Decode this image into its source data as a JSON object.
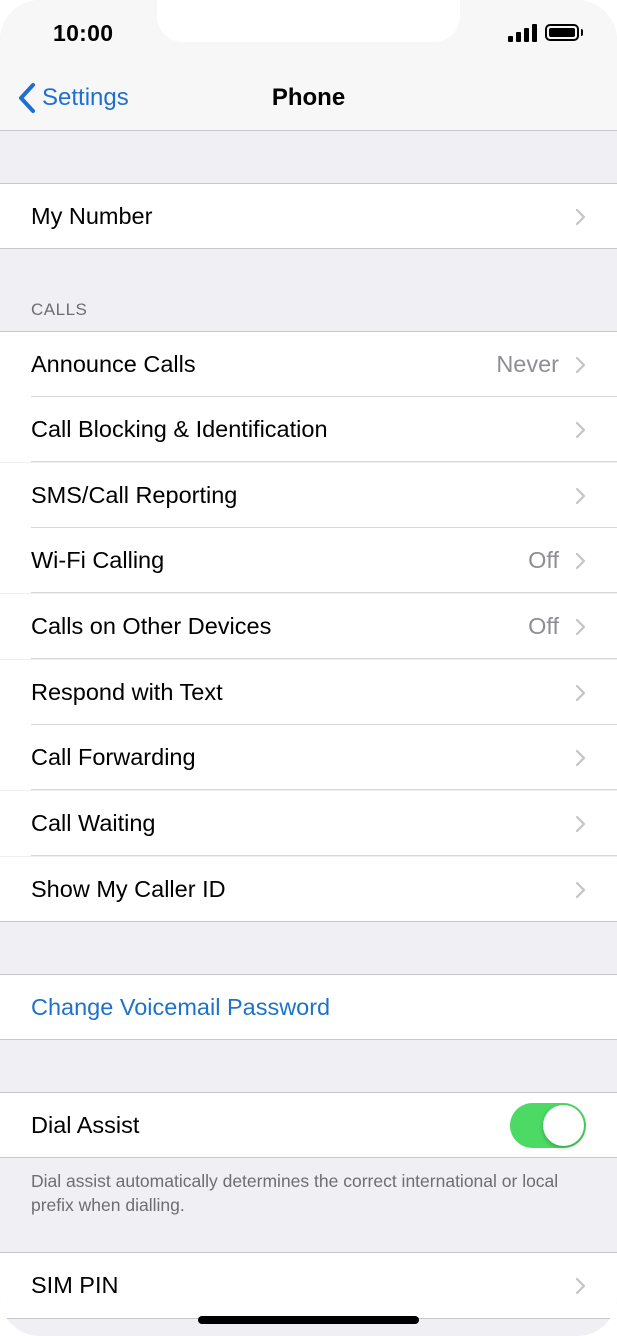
{
  "status_bar": {
    "time": "10:00"
  },
  "nav": {
    "back_label": "Settings",
    "title": "Phone"
  },
  "my_number": {
    "label": "My Number"
  },
  "calls_section": {
    "header": "CALLS",
    "items": [
      {
        "label": "Announce Calls",
        "value": "Never"
      },
      {
        "label": "Call Blocking & Identification",
        "value": ""
      },
      {
        "label": "SMS/Call Reporting",
        "value": ""
      },
      {
        "label": "Wi-Fi Calling",
        "value": "Off"
      },
      {
        "label": "Calls on Other Devices",
        "value": "Off"
      },
      {
        "label": "Respond with Text",
        "value": ""
      },
      {
        "label": "Call Forwarding",
        "value": ""
      },
      {
        "label": "Call Waiting",
        "value": ""
      },
      {
        "label": "Show My Caller ID",
        "value": ""
      }
    ]
  },
  "voicemail": {
    "label": "Change Voicemail Password"
  },
  "dial_assist": {
    "label": "Dial Assist",
    "enabled": true,
    "footer": "Dial assist automatically determines the correct international or local prefix when dialling."
  },
  "sim_pin": {
    "label": "SIM PIN"
  },
  "colors": {
    "accent": "#1f6fd1",
    "toggle_on": "#4cd964",
    "background": "#efeff4",
    "secondary_text": "#8e8e93"
  }
}
